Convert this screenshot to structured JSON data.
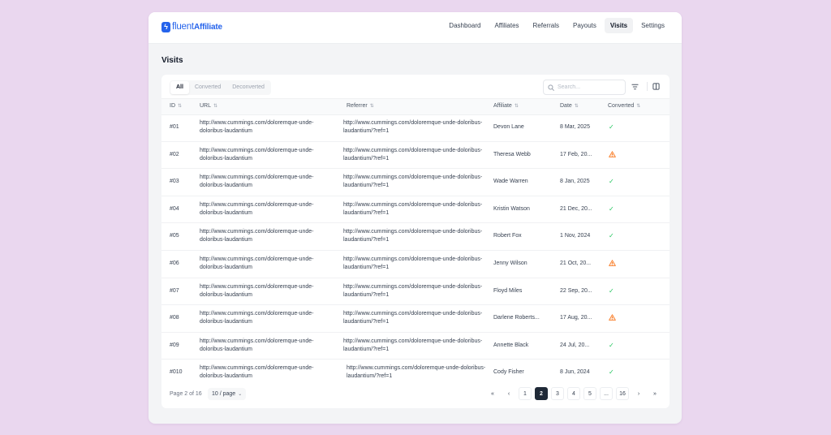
{
  "brand": {
    "name_light": "fluent",
    "name_bold": "Affiliate"
  },
  "nav": [
    {
      "label": "Dashboard"
    },
    {
      "label": "Affiliates"
    },
    {
      "label": "Referrals"
    },
    {
      "label": "Payouts"
    },
    {
      "label": "Visits",
      "active": true
    },
    {
      "label": "Settings"
    }
  ],
  "page": {
    "title": "Visits"
  },
  "filters": {
    "tabs": [
      "All",
      "Converted",
      "Deconverted"
    ],
    "active": "All"
  },
  "search": {
    "placeholder": "Search..."
  },
  "table": {
    "headers": {
      "id": "ID",
      "url": "URL",
      "referrer": "Referrer",
      "affiliate": "Affiliate",
      "date": "Date",
      "converted": "Converted"
    },
    "rows": [
      {
        "id": "#01",
        "url": "http://www.cummings.com/doloremque-unde-doloribus-laudantium",
        "referrer": "http://www.cummings.com/doloremque-unde-doloribus-laudantium/?ref=1",
        "affiliate": "Devon Lane",
        "date": "8 Mar, 2025",
        "converted": "check"
      },
      {
        "id": "#02",
        "url": "http://www.cummings.com/doloremque-unde-doloribus-laudantium",
        "referrer": "http://www.cummings.com/doloremque-unde-doloribus-laudantium/?ref=1",
        "affiliate": "Theresa Webb",
        "date": "17 Feb, 20...",
        "converted": "warning"
      },
      {
        "id": "#03",
        "url": "http://www.cummings.com/doloremque-unde-doloribus-laudantium",
        "referrer": "http://www.cummings.com/doloremque-unde-doloribus-laudantium/?ref=1",
        "affiliate": "Wade Warren",
        "date": "8 Jan, 2025",
        "converted": "check"
      },
      {
        "id": "#04",
        "url": "http://www.cummings.com/doloremque-unde-doloribus-laudantium",
        "referrer": "http://www.cummings.com/doloremque-unde-doloribus-laudantium/?ref=1",
        "affiliate": "Kristin Watson",
        "date": "21 Dec, 20...",
        "converted": "check"
      },
      {
        "id": "#05",
        "url": "http://www.cummings.com/doloremque-unde-doloribus-laudantium",
        "referrer": "http://www.cummings.com/doloremque-unde-doloribus-laudantium/?ref=1",
        "affiliate": "Robert Fox",
        "date": "1 Nov, 2024",
        "converted": "check"
      },
      {
        "id": "#06",
        "url": "http://www.cummings.com/doloremque-unde-doloribus-laudantium",
        "referrer": "http://www.cummings.com/doloremque-unde-doloribus-laudantium/?ref=1",
        "affiliate": "Jenny Wilson",
        "date": "21 Oct, 20...",
        "converted": "warning"
      },
      {
        "id": "#07",
        "url": "http://www.cummings.com/doloremque-unde-doloribus-laudantium",
        "referrer": "http://www.cummings.com/doloremque-unde-doloribus-laudantium/?ref=1",
        "affiliate": "Floyd Miles",
        "date": "22 Sep, 20...",
        "converted": "check"
      },
      {
        "id": "#08",
        "url": "http://www.cummings.com/doloremque-unde-doloribus-laudantium",
        "referrer": "http://www.cummings.com/doloremque-unde-doloribus-laudantium/?ref=1",
        "affiliate": "Darlene Roberts...",
        "date": "17 Aug, 20...",
        "converted": "warning"
      },
      {
        "id": "#09",
        "url": "http://www.cummings.com/doloremque-unde-doloribus-laudantium",
        "referrer": "http://www.cummings.com/doloremque-unde-doloribus-laudantium/?ref=1",
        "affiliate": "Annette Black",
        "date": "24 Jul, 20...",
        "converted": "check"
      },
      {
        "id": "#010",
        "url": "http://www.cummings.com/doloremque-unde-doloribus-laudantium",
        "referrer": "http://www.cummings.com/doloremque-unde-doloribus-laudantium/?ref=1",
        "affiliate": "Cody Fisher",
        "date": "8 Jun, 2024",
        "converted": "check"
      }
    ]
  },
  "pagination": {
    "info": "Page 2 of 16",
    "per_page": "10 / page",
    "first": "«",
    "prev": "‹",
    "next": "›",
    "last": "»",
    "pages": [
      "1",
      "2",
      "3",
      "4",
      "5",
      "...",
      "16"
    ],
    "current": "2"
  },
  "colors": {
    "brand": "#2563eb",
    "success": "#22c55e",
    "warning": "#f97316",
    "background": "#ead7ef"
  }
}
